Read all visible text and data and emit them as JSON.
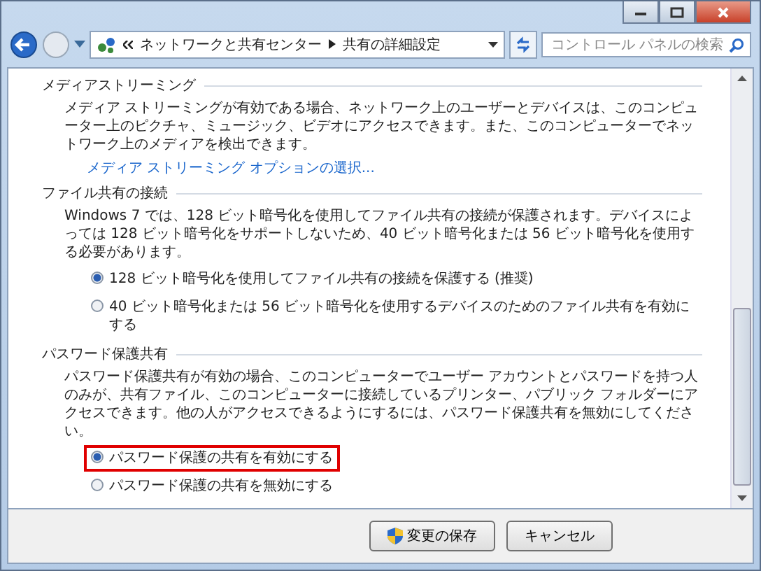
{
  "address_bar": {
    "crumbs": [
      "ネットワークと共有センター",
      "共有の詳細設定"
    ]
  },
  "search": {
    "placeholder": "コントロール パネルの検索"
  },
  "sections": [
    {
      "heading": "メディアストリーミング",
      "text": "メディア ストリーミングが有効である場合、ネットワーク上のユーザーとデバイスは、このコンピューター上のピクチャ、ミュージック、ビデオにアクセスできます。また、このコンピューターでネットワーク上のメディアを検出できます。",
      "link": "メディア ストリーミング オプションの選択..."
    },
    {
      "heading": "ファイル共有の接続",
      "text": "Windows 7 では、128 ビット暗号化を使用してファイル共有の接続が保護されます。デバイスによっては 128 ビット暗号化をサポートしないため、40 ビット暗号化または 56 ビット暗号化を使用する必要があります。",
      "options": [
        {
          "label": "128 ビット暗号化を使用してファイル共有の接続を保護する (推奨)",
          "selected": true,
          "highlighted": false
        },
        {
          "label": "40 ビット暗号化または 56 ビット暗号化を使用するデバイスのためのファイル共有を有効にする",
          "selected": false,
          "highlighted": false
        }
      ]
    },
    {
      "heading": "パスワード保護共有",
      "text": "パスワード保護共有が有効の場合、このコンピューターでユーザー アカウントとパスワードを持つ人のみが、共有ファイル、このコンピューターに接続しているプリンター、パブリック フォルダーにアクセスできます。他の人がアクセスできるようにするには、パスワード保護共有を無効にしてください。",
      "options": [
        {
          "label": "パスワード保護の共有を有効にする",
          "selected": true,
          "highlighted": true
        },
        {
          "label": "パスワード保護の共有を無効にする",
          "selected": false,
          "highlighted": false
        }
      ]
    }
  ],
  "buttons": [
    {
      "label": "変更の保存",
      "kind": "shield"
    },
    {
      "label": "キャンセル",
      "kind": "plain"
    }
  ]
}
